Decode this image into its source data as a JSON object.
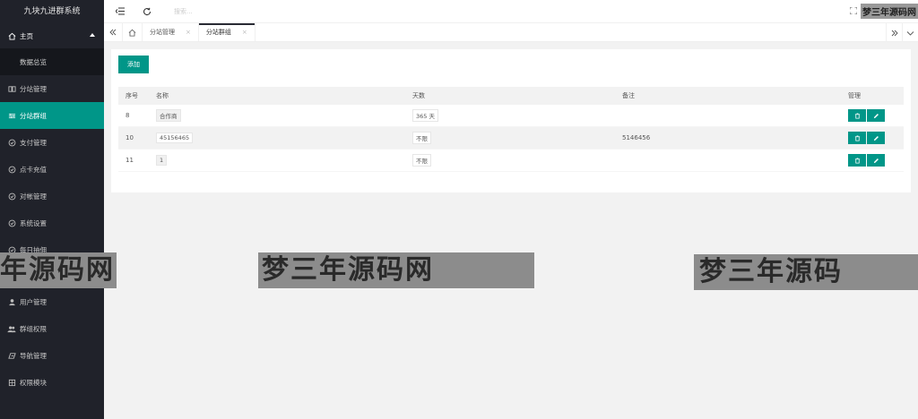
{
  "app": {
    "title": "九块九进群系统"
  },
  "sidebar": {
    "home": {
      "label": "主页"
    },
    "home_sub": {
      "label": "数据总览"
    },
    "items": [
      {
        "label": "分站管理",
        "icon": "columns-icon"
      },
      {
        "label": "分站群组",
        "icon": "sliders-icon"
      },
      {
        "label": "支付管理",
        "icon": "shield-icon"
      },
      {
        "label": "点卡充值",
        "icon": "shield-icon"
      },
      {
        "label": "对帐管理",
        "icon": "shield-icon"
      },
      {
        "label": "系统设置",
        "icon": "shield-icon"
      },
      {
        "label": "每日抽佣",
        "icon": "shield-icon"
      },
      {
        "label": "用户管理",
        "icon": "user-icon"
      },
      {
        "label": "群组权限",
        "icon": "users-icon"
      },
      {
        "label": "导航管理",
        "icon": "nav-icon"
      },
      {
        "label": "权限模块",
        "icon": "module-icon"
      }
    ],
    "active_index": 1
  },
  "header": {
    "search_placeholder": "搜索..."
  },
  "tabs": [
    {
      "label": "分站管理"
    },
    {
      "label": "分站群组"
    }
  ],
  "toolbar": {
    "add_label": "添加"
  },
  "table": {
    "columns": [
      "序号",
      "名称",
      "天数",
      "备注",
      "管理"
    ],
    "rows": [
      {
        "id": "8",
        "name": "合作商",
        "days": "365 天",
        "note": ""
      },
      {
        "id": "10",
        "name": "45156465",
        "days": "不限",
        "note": "5146456"
      },
      {
        "id": "11",
        "name": "1",
        "days": "不限",
        "note": ""
      }
    ]
  },
  "watermarks": {
    "top": "梦三年源码网",
    "left": "年源码网",
    "center": "梦三年源码网",
    "right": "梦三年源码"
  },
  "colors": {
    "accent": "#009688",
    "sidebar": "#20222a"
  }
}
